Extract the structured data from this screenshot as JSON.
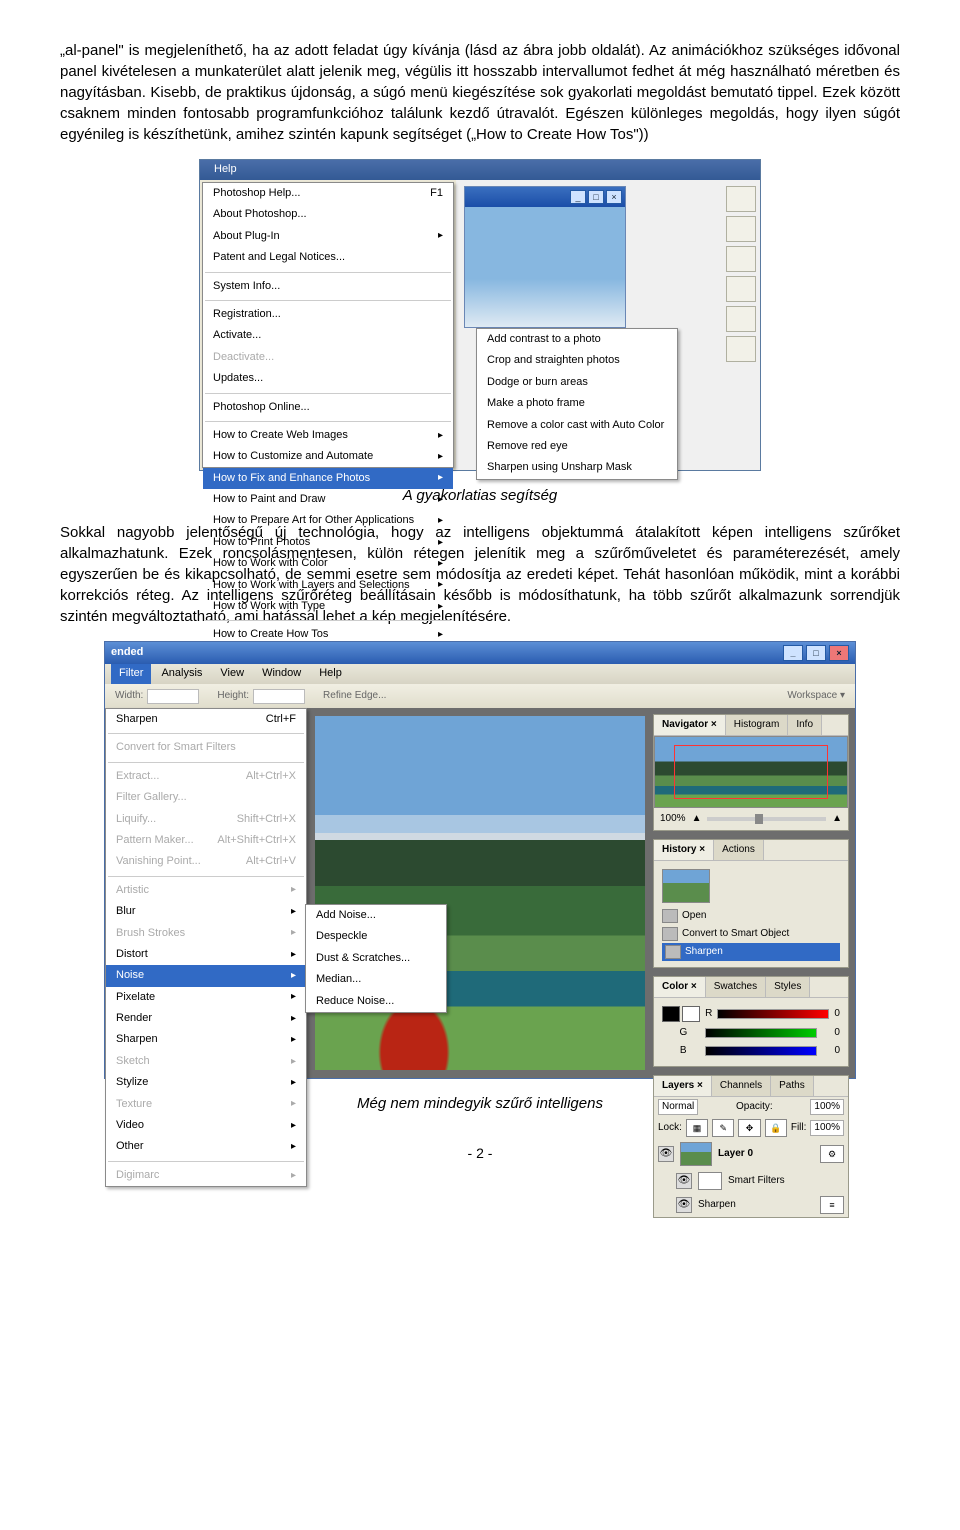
{
  "para1": "„al-panel\" is megjeleníthető, ha az adott feladat úgy kívánja (lásd az ábra jobb oldalát). Az animációkhoz szükséges idővonal panel kivételesen a munkaterület alatt jelenik meg, végülis itt hosszabb intervallumot fedhet át még használható méretben és nagyításban. Kisebb, de praktikus újdonság, a súgó menü kiegészítése sok gyakorlati megoldást bemutató tippel. Ezek között csaknem minden fontosabb programfunkcióhoz találunk kezdő útravalót. Egészen különleges megoldás, hogy ilyen súgót egyénileg is készíthetünk, amihez szintén kapunk segítséget („How to Create How Tos\"))",
  "caption1": "A gyakorlatias segítség",
  "para2": "Sokkal nagyobb jelentőségű új technológia, hogy az intelligens objektummá átalakított képen intelligens szűrőket alkalmazhatunk. Ezek roncsolásmentesen, külön rétegen jelenítik meg a szűrőműveletet és paraméterezését, amely egyszerűen be és kikapcsolható, de semmi esetre sem módosítja az eredeti képet. Tehát hasonlóan működik, mint a korábbi korrekciós réteg. Az intelligens szűrőréteg beállításain később is módosíthatunk, ha több szűrőt alkalmazunk sorrendjük szintén megváltoztatható, ami hatással lehet a kép megjelenítésére.",
  "caption2": "Még nem mindegyik szűrő intelligens",
  "pagefoot": "- 2 -",
  "ss1": {
    "menubar": {
      "help": "Help"
    },
    "menu": {
      "photoshop_help": "Photoshop Help...",
      "photoshop_help_key": "F1",
      "about_photoshop": "About Photoshop...",
      "about_plugin": "About Plug-In",
      "patent": "Patent and Legal Notices...",
      "system_info": "System Info...",
      "registration": "Registration...",
      "activate": "Activate...",
      "deactivate": "Deactivate...",
      "updates": "Updates...",
      "online": "Photoshop Online...",
      "howto_web": "How to Create Web Images",
      "howto_custom": "How to Customize and Automate",
      "howto_fix": "How to Fix and Enhance Photos",
      "howto_paint": "How to Paint and Draw",
      "howto_prepare": "How to Prepare Art for Other Applications",
      "howto_print": "How to Print Photos",
      "howto_color": "How to Work with Color",
      "howto_layers": "How to Work with Layers and Selections",
      "howto_type": "How to Work with Type",
      "howto_create": "How to Create How Tos"
    },
    "submenu": {
      "add_contrast": "Add contrast to a photo",
      "crop": "Crop and straighten photos",
      "dodge": "Dodge or burn areas",
      "frame": "Make a photo frame",
      "remove_cast": "Remove a color cast with Auto Color",
      "redeye": "Remove red eye",
      "sharpen": "Sharpen using Unsharp Mask"
    }
  },
  "ss2": {
    "title": "ended",
    "winbtn_min": "_",
    "winbtn_max": "□",
    "winbtn_close": "×",
    "menu": {
      "filter": "Filter",
      "analysis": "Analysis",
      "view": "View",
      "window": "Window",
      "help": "Help"
    },
    "optbar": {
      "width": "Width:",
      "height": "Height:",
      "refine": "Refine Edge...",
      "workspace": "Workspace ▾"
    },
    "filtmenu": {
      "sharpen_last": "Sharpen",
      "sharpen_key": "Ctrl+F",
      "convert": "Convert for Smart Filters",
      "extract": "Extract...",
      "extract_key": "Alt+Ctrl+X",
      "gallery": "Filter Gallery...",
      "liquify": "Liquify...",
      "liquify_key": "Shift+Ctrl+X",
      "pattern": "Pattern Maker...",
      "pattern_key": "Alt+Shift+Ctrl+X",
      "vanish": "Vanishing Point...",
      "vanish_key": "Alt+Ctrl+V",
      "artistic": "Artistic",
      "blur": "Blur",
      "brush": "Brush Strokes",
      "distort": "Distort",
      "noise": "Noise",
      "pixelate": "Pixelate",
      "render": "Render",
      "sharpen": "Sharpen",
      "sketch": "Sketch",
      "stylize": "Stylize",
      "texture": "Texture",
      "video": "Video",
      "other": "Other",
      "digimarc": "Digimarc"
    },
    "subfilt": {
      "add_noise": "Add Noise...",
      "despeckle": "Despeckle",
      "dust": "Dust & Scratches...",
      "median": "Median...",
      "reduce": "Reduce Noise..."
    },
    "panels": {
      "nav": {
        "tab1": "Navigator ×",
        "tab2": "Histogram",
        "tab3": "Info",
        "zoom": "100%"
      },
      "hist": {
        "tab1": "History ×",
        "tab2": "Actions",
        "open": "Open",
        "convert": "Convert to Smart Object",
        "sharpen": "Sharpen"
      },
      "color": {
        "tab1": "Color ×",
        "tab2": "Swatches",
        "tab3": "Styles",
        "r": "R",
        "g": "G",
        "b": "B",
        "rv": "0",
        "gv": "0",
        "bv": "0"
      },
      "layers": {
        "tab1": "Layers ×",
        "tab2": "Channels",
        "tab3": "Paths",
        "mode": "Normal",
        "opacity_lbl": "Opacity:",
        "opacity": "100%",
        "lock": "Lock:",
        "fill_lbl": "Fill:",
        "fill": "100%",
        "layer0": "Layer 0",
        "smart": "Smart Filters",
        "sharpen": "Sharpen"
      }
    }
  }
}
